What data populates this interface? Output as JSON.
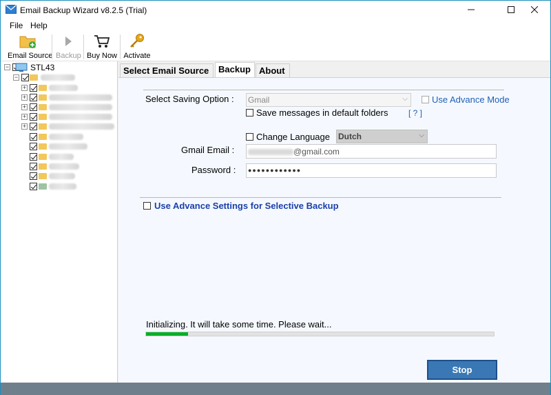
{
  "window": {
    "title": "Email Backup Wizard v8.2.5 (Trial)"
  },
  "menu": {
    "items": [
      "File",
      "Help"
    ]
  },
  "toolbar": {
    "email_source": "Email Source",
    "backup": "Backup",
    "buy_now": "Buy Now",
    "activate": "Activate"
  },
  "tree": {
    "root": "STL43"
  },
  "tabs": [
    "Select Email Source",
    "Backup",
    "About"
  ],
  "backup": {
    "saving_option_label": "Select Saving Option :",
    "saving_option_value": "Gmail",
    "use_advance_mode": "Use Advance Mode",
    "save_default_folders": "Save messages in default folders",
    "help": "[ ? ]",
    "change_language": "Change Language",
    "language_value": "Dutch",
    "gmail_email_label": "Gmail Email :",
    "gmail_email_suffix": "@gmail.com",
    "password_label": "Password :",
    "password_value": "●●●●●●●●●●●●",
    "advance_settings": "Use Advance Settings for Selective Backup",
    "status": "Initializing. It will take some time. Please wait...",
    "progress": 0.12,
    "stop": "Stop"
  },
  "colors": {
    "progress": "#06b025",
    "stop_button": "#3a78b5",
    "link": "#1a3fa8",
    "statusbar": "#6f7f8c"
  }
}
